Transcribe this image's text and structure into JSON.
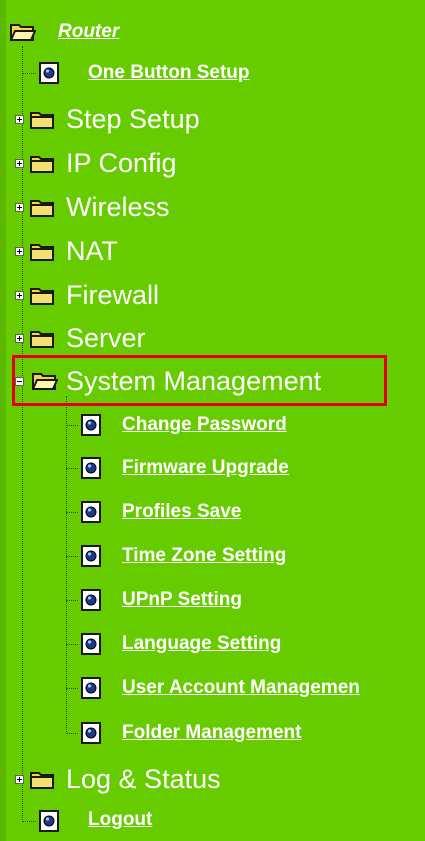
{
  "tree": {
    "root": {
      "label": "Router",
      "icon": "open-folder-icon"
    },
    "items": [
      {
        "label": "One Button Setup",
        "type": "page",
        "icon": "page-icon"
      },
      {
        "label": "Step Setup",
        "type": "folder",
        "expanded": false,
        "icon": "folder-icon"
      },
      {
        "label": "IP Config",
        "type": "folder",
        "expanded": false,
        "icon": "folder-icon"
      },
      {
        "label": "Wireless",
        "type": "folder",
        "expanded": false,
        "icon": "folder-icon"
      },
      {
        "label": "NAT",
        "type": "folder",
        "expanded": false,
        "icon": "folder-icon"
      },
      {
        "label": "Firewall",
        "type": "folder",
        "expanded": false,
        "icon": "folder-icon"
      },
      {
        "label": "Server",
        "type": "folder",
        "expanded": false,
        "icon": "folder-icon"
      },
      {
        "label": "System Management",
        "type": "folder",
        "expanded": true,
        "highlighted": true,
        "icon": "open-folder-icon",
        "children": [
          {
            "label": "Change Password",
            "icon": "page-icon"
          },
          {
            "label": "Firmware Upgrade",
            "icon": "page-icon"
          },
          {
            "label": "Profiles Save",
            "icon": "page-icon"
          },
          {
            "label": "Time Zone Setting",
            "icon": "page-icon"
          },
          {
            "label": "UPnP Setting",
            "icon": "page-icon"
          },
          {
            "label": "Language Setting",
            "icon": "page-icon"
          },
          {
            "label": "User Account Managemen",
            "icon": "page-icon"
          },
          {
            "label": "Folder Management",
            "icon": "page-icon"
          }
        ]
      },
      {
        "label": "Log & Status",
        "type": "folder",
        "expanded": false,
        "icon": "folder-icon"
      },
      {
        "label": "Logout",
        "type": "page",
        "icon": "page-icon"
      }
    ]
  },
  "colors": {
    "background": "#66cc00",
    "text": "#ffffff",
    "highlight_border": "#e0001a",
    "folder_fill": "#f0d840"
  }
}
